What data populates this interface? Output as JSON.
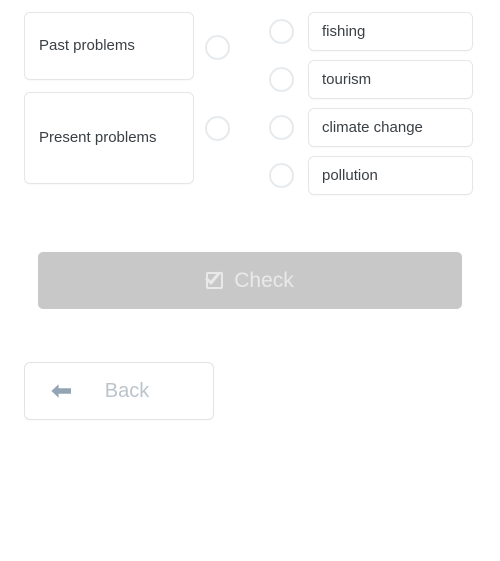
{
  "exercise": {
    "prompts": [
      {
        "label": "Past problems"
      },
      {
        "label": "Present problems"
      }
    ],
    "options": [
      {
        "label": "fishing"
      },
      {
        "label": "tourism"
      },
      {
        "label": "climate change"
      },
      {
        "label": "pollution"
      }
    ]
  },
  "actions": {
    "check_label": "Check",
    "check_icon": "check-square-icon",
    "back_label": "Back",
    "back_icon": "arrow-left-icon"
  },
  "colors": {
    "page_background": "#ffffff",
    "card_border": "#e4e7ea",
    "text": "#3a3f44",
    "radio_border": "#e7eaec",
    "check_button_background": "#c8c8c8",
    "check_button_text": "#e9e9e9",
    "back_text": "#bcc4cb",
    "back_arrow": "#93a5b5",
    "back_border": "#e0e4e7"
  }
}
